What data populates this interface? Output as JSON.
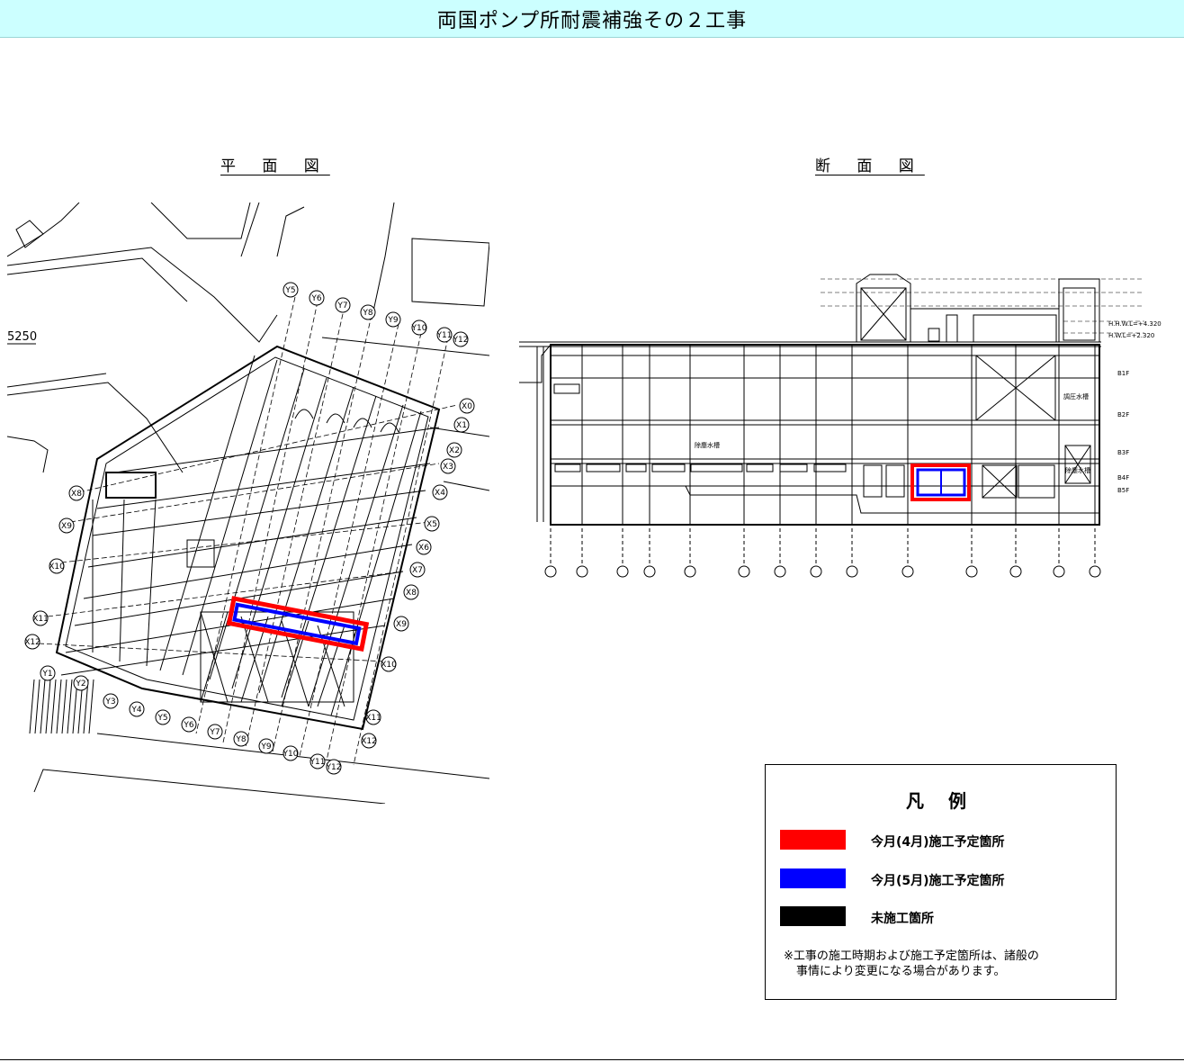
{
  "title": "両国ポンプ所耐震補強その２工事",
  "plan_view": {
    "label": "平 面 図",
    "top_text": "5250",
    "x_grid": [
      "X0",
      "X1",
      "X2",
      "X3",
      "X4",
      "X5",
      "X6",
      "X7",
      "X8",
      "X9",
      "X10",
      "X11",
      "X12"
    ],
    "x_grid_left": [
      "X8",
      "X9",
      "X10",
      "X11",
      "X12"
    ],
    "y_grid": [
      "Y1",
      "Y2",
      "Y3",
      "Y4",
      "Y5",
      "Y6",
      "Y7",
      "Y8",
      "Y9",
      "Y10",
      "Y11",
      "Y12"
    ]
  },
  "section_view": {
    "label": "断 面 図",
    "level_labels": [
      "H.H.W.L=+4.320",
      "H.W.L=+2.320",
      "B1F",
      "B2F",
      "B3F",
      "B4F",
      "B5F"
    ],
    "room_labels": [
      "除塵水槽",
      "除塵水槽",
      "調圧水槽"
    ]
  },
  "legend": {
    "title": "凡 例",
    "items": [
      {
        "color": "#ff0000",
        "label": "今月(4月)施工予定箇所"
      },
      {
        "color": "#0000ff",
        "label": "今月(5月)施工予定箇所"
      },
      {
        "color": "#000000",
        "label": "未施工箇所"
      }
    ],
    "note_line1": "※工事の施工時期および施工予定箇所は、諸般の",
    "note_line2": "事情により変更になる場合があります。"
  }
}
